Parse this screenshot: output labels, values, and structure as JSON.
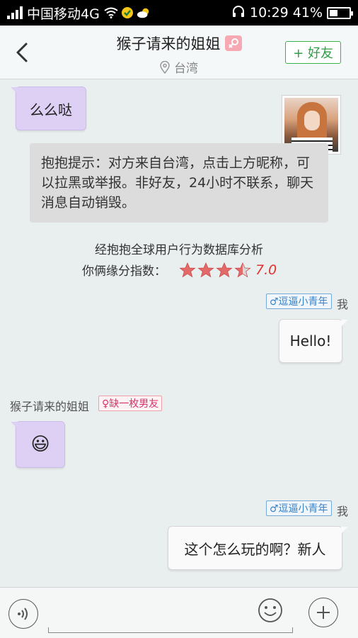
{
  "status_bar": {
    "carrier": "中国移动4G",
    "time": "10:29",
    "battery": "41%",
    "battery_level": 0.41
  },
  "header": {
    "title": "猴子请来的姐姐",
    "location": "台湾",
    "add_friend": "+ 好友"
  },
  "chat": {
    "msg1": "么么哒",
    "system_notice": "抱抱提示：对方来自台湾，点击上方昵称，可以拉黑或举报。非好友，24小时不联系，聊天消息自动销毁。",
    "analysis_line1": "经抱抱全球用户行为数据库分析",
    "analysis_label": "你俩缘分指数：",
    "score": "7.0",
    "star_rating": 3.5,
    "my_tag": "♂逗逼小青年",
    "me_label": "我",
    "msg2": "Hello!",
    "peer_name": "猴子请来的姐姐",
    "peer_tag": "♀缺一枚男友",
    "msg3": "😃",
    "my_tag2": "♂逗逼小青年",
    "me_label2": "我",
    "msg4": "这个怎么玩的啊？新人"
  },
  "colors": {
    "accent_green": "#37b24d",
    "purple_bubble": "#ddd0f4",
    "star_red": "#e05a5a"
  }
}
